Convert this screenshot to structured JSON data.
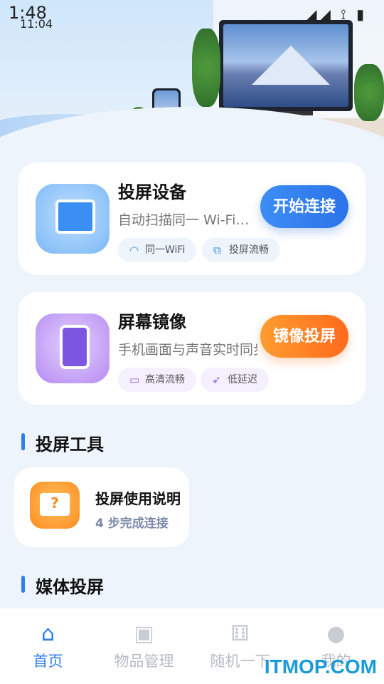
{
  "status_bar": {
    "time_large": "1:48",
    "time_small": "11:04",
    "icons": "◢◢ ⟟ ▮"
  },
  "card_cast": {
    "title": "投屏设备",
    "desc": "自动扫描同一 Wi-Fi下的设备",
    "tags": [
      {
        "icon": "wifi-icon",
        "label": "同一WiFi"
      },
      {
        "icon": "screens-icon",
        "label": "投屏流畅"
      }
    ],
    "button": "开始连接"
  },
  "card_mirror": {
    "title": "屏幕镜像",
    "desc": "手机画面与声音实时同步",
    "tags": [
      {
        "icon": "hd-icon",
        "label": "高清流畅"
      },
      {
        "icon": "rocket-icon",
        "label": "低延迟"
      }
    ],
    "button": "镜像投屏"
  },
  "section_tools": "投屏工具",
  "tool_guide": {
    "title": "投屏使用说明",
    "subtitle": "4 步完成连接"
  },
  "section_media": "媒体投屏",
  "tabs": [
    {
      "icon": "home-icon",
      "label": "首页",
      "active": true
    },
    {
      "icon": "box-icon",
      "label": "物品管理",
      "active": false
    },
    {
      "icon": "dice-icon",
      "label": "随机一下",
      "active": false
    },
    {
      "icon": "user-icon",
      "label": "我的",
      "active": false
    }
  ],
  "watermark": "ITMOP.COM",
  "colors": {
    "primary": "#2f7df0",
    "orange": "#ff7a22",
    "purple": "#8c62e6"
  }
}
